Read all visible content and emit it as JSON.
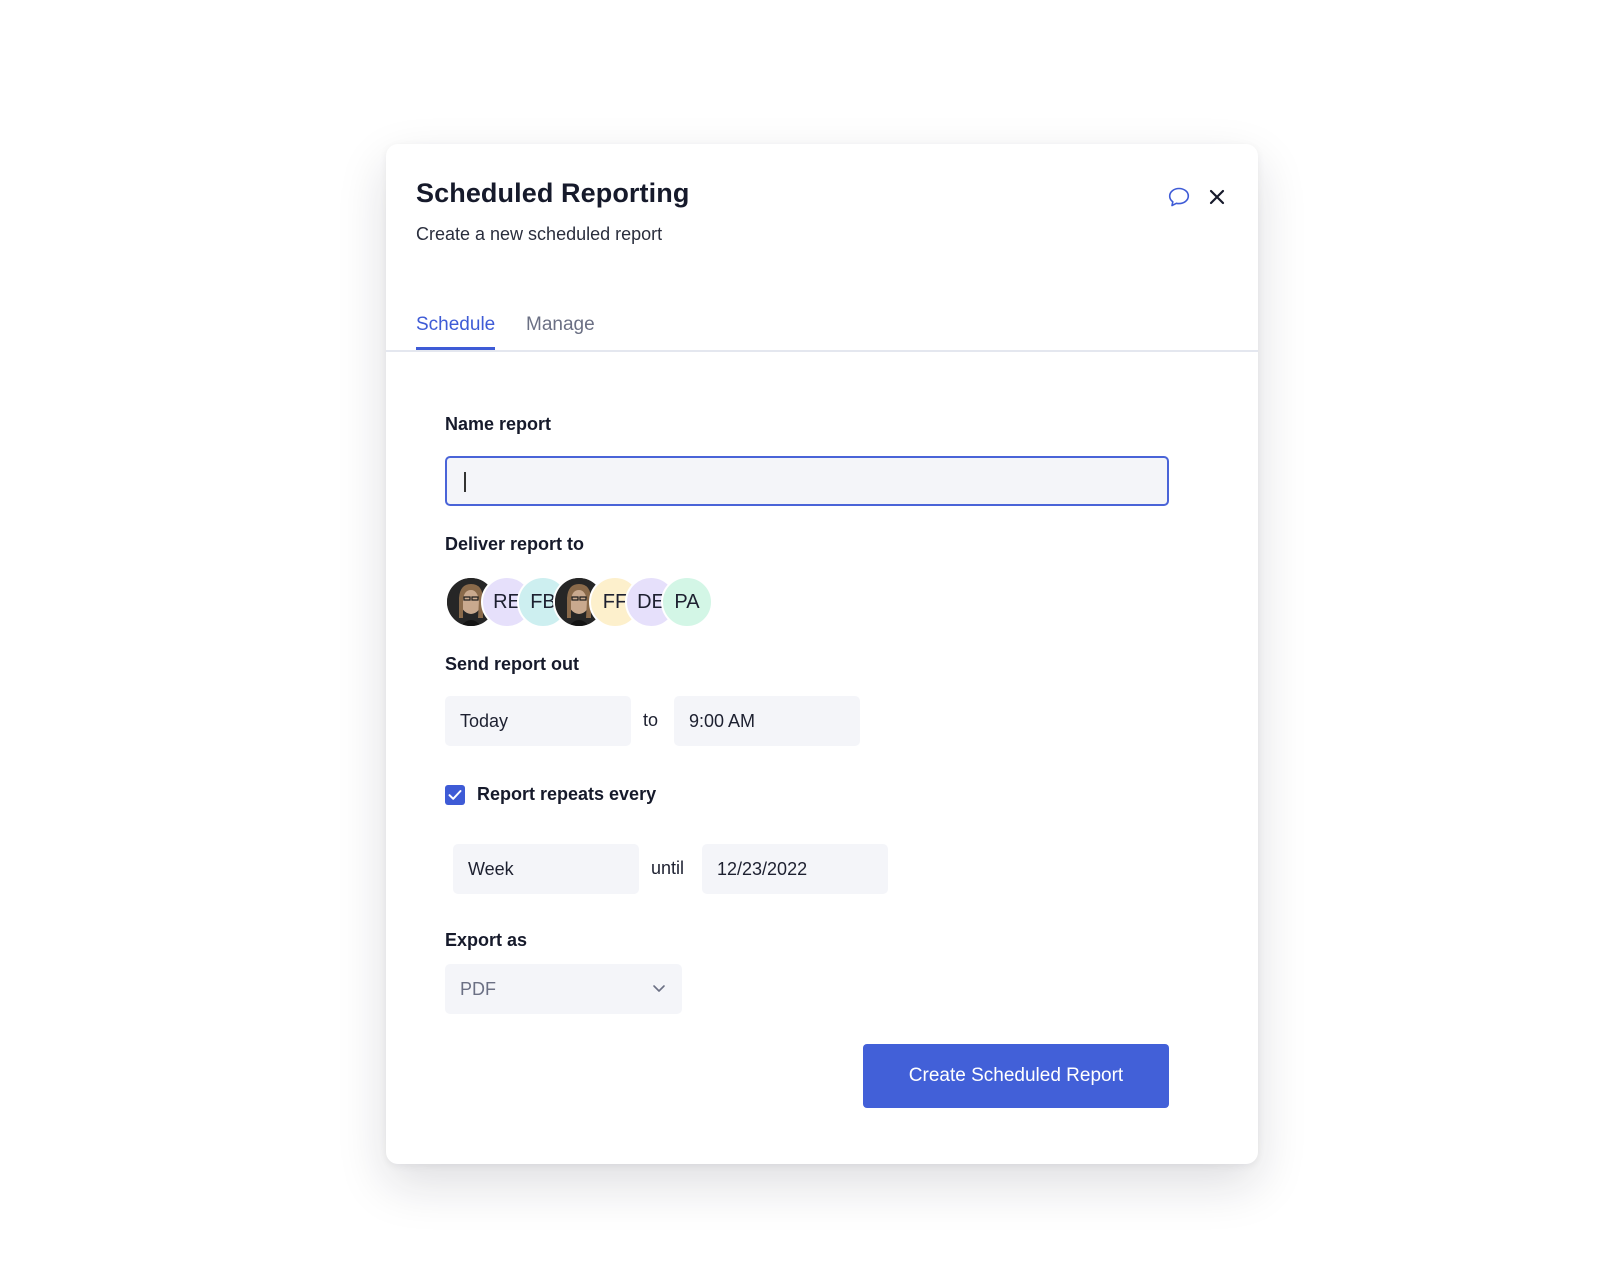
{
  "modal": {
    "title": "Scheduled Reporting",
    "subtitle": "Create a new scheduled report"
  },
  "header_icons": {
    "chat": "chat-bubble-icon",
    "close": "close-icon",
    "accent": "#3e5bd6"
  },
  "tabs": [
    {
      "label": "Schedule",
      "active": true
    },
    {
      "label": "Manage",
      "active": false
    }
  ],
  "form": {
    "name_label": "Name report",
    "name_value": "",
    "deliver_label": "Deliver report to",
    "recipients": [
      {
        "initials": "",
        "photo": true,
        "color": "#2b2b2b"
      },
      {
        "initials": "RE",
        "photo": false,
        "color": "#e6e0fb"
      },
      {
        "initials": "FB",
        "photo": false,
        "color": "#cdeff0"
      },
      {
        "initials": "",
        "photo": true,
        "color": "#2b2b2b"
      },
      {
        "initials": "FF",
        "photo": false,
        "color": "#fdf0cc"
      },
      {
        "initials": "DE",
        "photo": false,
        "color": "#e6e0fb"
      },
      {
        "initials": "PA",
        "photo": false,
        "color": "#d3f6e6"
      }
    ],
    "send_label": "Send report out",
    "send_day": "Today",
    "send_connector": "to",
    "send_time": "9:00 AM",
    "repeat_checked": true,
    "repeat_label": "Report repeats every",
    "repeat_interval": "Week",
    "repeat_connector": "until",
    "repeat_until": "12/23/2022",
    "export_label": "Export as",
    "export_value": "PDF",
    "submit_label": "Create Scheduled Report"
  },
  "colors": {
    "primary": "#4260d8",
    "field_bg": "#f4f5f9"
  }
}
